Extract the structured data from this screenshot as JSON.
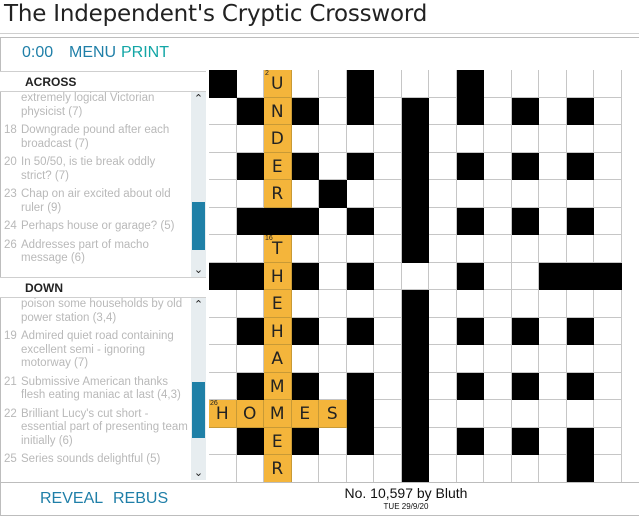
{
  "page": {
    "title": "The Independent's Cryptic Crossword"
  },
  "toolbar": {
    "timer": "0:00",
    "menu_label": "MENU",
    "print_label": "PRINT"
  },
  "clues": {
    "across_heading": "ACROSS",
    "down_heading": "DOWN",
    "across": [
      {
        "num": "",
        "text": "extremely logical Victorian physicist (7)"
      },
      {
        "num": "18",
        "text": "Downgrade pound after each broadcast (7)"
      },
      {
        "num": "20",
        "text": "In 50/50, is tie break oddly strict? (7)"
      },
      {
        "num": "23",
        "text": "Chap on air excited about old ruler (9)"
      },
      {
        "num": "24",
        "text": "Perhaps house or garage? (5)"
      },
      {
        "num": "26",
        "text": "Addresses part of macho message (6)"
      }
    ],
    "down": [
      {
        "num": "",
        "text": "poison some households by old power station (3,4)"
      },
      {
        "num": "19",
        "text": "Admired quiet road containing excellent semi - ignoring motorway (7)"
      },
      {
        "num": "21",
        "text": "Submissive American thanks flesh eating maniac at last (4,3)"
      },
      {
        "num": "22",
        "text": "Brilliant Lucy's cut short - essential part of presenting team initially (6)"
      },
      {
        "num": "25",
        "text": "Series sounds delightful (5)"
      }
    ]
  },
  "grid": {
    "rows": 15,
    "cols": 15,
    "pattern": [
      "#....#...#.....",
      ".#.#.#.#.#.#.#.",
      ".......#.......",
      ".#.#.#.#.#.#.#.",
      "....#..#.......",
      ".###.#.#.#.#.#.",
      ".......#.......",
      "####.#...#..###",
      ".......#.......",
      ".#.#.#.#.#.#.#.",
      ".......#.......",
      ".#.#.#.#.#.#.#.",
      ".....#.#.......",
      ".#.#.#.#.#.#.#.",
      ".......#.....#."
    ],
    "numbers": [
      {
        "r": 0,
        "c": 2,
        "n": "2"
      },
      {
        "r": 6,
        "c": 2,
        "n": "16"
      },
      {
        "r": 12,
        "c": 0,
        "n": "26"
      }
    ],
    "letters": [
      {
        "r": 0,
        "c": 2,
        "ch": "U"
      },
      {
        "r": 1,
        "c": 2,
        "ch": "N"
      },
      {
        "r": 2,
        "c": 2,
        "ch": "D"
      },
      {
        "r": 3,
        "c": 2,
        "ch": "E"
      },
      {
        "r": 4,
        "c": 2,
        "ch": "R"
      },
      {
        "r": 6,
        "c": 2,
        "ch": "T"
      },
      {
        "r": 7,
        "c": 2,
        "ch": "H"
      },
      {
        "r": 8,
        "c": 2,
        "ch": "E"
      },
      {
        "r": 9,
        "c": 2,
        "ch": "H"
      },
      {
        "r": 10,
        "c": 2,
        "ch": "A"
      },
      {
        "r": 11,
        "c": 2,
        "ch": "M"
      },
      {
        "r": 12,
        "c": 0,
        "ch": "H"
      },
      {
        "r": 12,
        "c": 1,
        "ch": "O"
      },
      {
        "r": 12,
        "c": 2,
        "ch": "M"
      },
      {
        "r": 12,
        "c": 3,
        "ch": "E"
      },
      {
        "r": 12,
        "c": 4,
        "ch": "S"
      },
      {
        "r": 13,
        "c": 2,
        "ch": "E"
      },
      {
        "r": 14,
        "c": 2,
        "ch": "R"
      }
    ],
    "highlight": [
      {
        "r": 0,
        "c": 2
      },
      {
        "r": 1,
        "c": 2
      },
      {
        "r": 2,
        "c": 2
      },
      {
        "r": 3,
        "c": 2
      },
      {
        "r": 4,
        "c": 2
      },
      {
        "r": 6,
        "c": 2
      },
      {
        "r": 7,
        "c": 2
      },
      {
        "r": 8,
        "c": 2
      },
      {
        "r": 9,
        "c": 2
      },
      {
        "r": 10,
        "c": 2
      },
      {
        "r": 11,
        "c": 2
      },
      {
        "r": 12,
        "c": 2
      },
      {
        "r": 13,
        "c": 2
      },
      {
        "r": 14,
        "c": 2
      },
      {
        "r": 12,
        "c": 0
      },
      {
        "r": 12,
        "c": 1
      },
      {
        "r": 12,
        "c": 3
      },
      {
        "r": 12,
        "c": 4
      }
    ],
    "colors": {
      "highlight": "#f4b53b",
      "block": "#000000"
    }
  },
  "bottom": {
    "reveal_label": "REVEAL",
    "rebus_label": "REBUS",
    "puzzle_number": "No. 10,597 by Bluth",
    "puzzle_date": "TUE 29/9/20"
  },
  "icons": {
    "scroll_up": "chevron-up-icon",
    "scroll_down": "chevron-down-icon"
  },
  "accent_color": "#1f7fa8"
}
